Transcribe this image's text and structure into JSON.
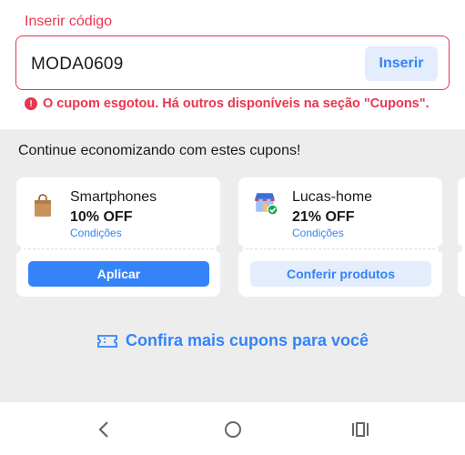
{
  "code_input": {
    "label": "Inserir código",
    "value": "MODA0609",
    "button": "Inserir",
    "error": "O cupom esgotou. Há outros disponíveis na seção \"Cupons\".",
    "error_icon": "!"
  },
  "coupons": {
    "title": "Continue economizando com estes cupons!",
    "items": [
      {
        "name": "Smartphones",
        "discount": "10% OFF",
        "conditions": "Condições",
        "button": "Aplicar",
        "icon": "shopping-bag-icon"
      },
      {
        "name": "Lucas-home",
        "discount": "21% OFF",
        "conditions": "Condições",
        "button": "Conferir produtos",
        "icon": "store-verified-icon"
      }
    ],
    "more_link": "Confira mais cupons para você"
  },
  "colors": {
    "accent": "#3483fa",
    "error": "#e8364f",
    "background": "#ededed"
  },
  "navbar": {
    "icons": [
      "back-icon",
      "home-icon",
      "recent-apps-icon"
    ]
  }
}
